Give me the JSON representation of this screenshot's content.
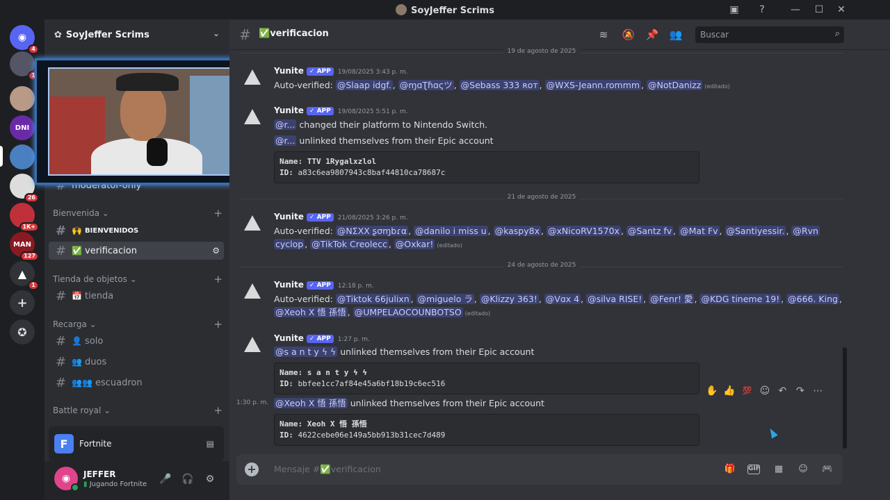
{
  "window": {
    "title": "SoyJeffer Scrims"
  },
  "rail": {
    "badges": [
      "4",
      "1",
      "1",
      "26",
      "1K+",
      "127",
      "1"
    ],
    "labels": {
      "dni": "DNI",
      "man": "MAN"
    }
  },
  "sidebar": {
    "guild_name": "SoyJeffer Scrims",
    "partial_channel": "moderator-only",
    "categories": {
      "bienvenida": "Bienvenida",
      "tienda": "Tienda de objetos",
      "recarga": "Recarga",
      "battle": "Battle royal"
    },
    "channels": {
      "bienvenidos": "BIENVENIDOS",
      "verificacion": "verificacion",
      "tienda": "tienda",
      "solo": "solo",
      "duos": "duos",
      "escuadron": "escuadron",
      "solo2": "solo"
    },
    "activity": {
      "app": "Fortnite",
      "icon_letter": "F"
    },
    "user": {
      "name": "JEFFER",
      "status": "Jugando Fortnite"
    }
  },
  "header": {
    "channel": "verificacion",
    "search_placeholder": "Buscar"
  },
  "messages": {
    "d1": "19 de agosto de 2025",
    "d2": "21 de agosto de 2025",
    "d3": "24 de agosto de 2025",
    "author": "Yunite",
    "app_tag": "APP",
    "edited": "(editado)",
    "m1": {
      "time": "19/08/2025 3:43 p. m.",
      "prefix": "Auto-verified:",
      "mentions": [
        "@Slaap idgf.",
        "@ɱɑƮɦɑςツ",
        "@Sebass 333 ʀᴏᴛ",
        "@WXS-Jeann.rommm",
        "@NotDanizz"
      ]
    },
    "m2": {
      "time": "19/08/2025 5:51 p. m.",
      "mention": "@r...",
      "line1": "changed their platform to Nintendo Switch.",
      "line2": "unlinked themselves from their Epic account",
      "code_name_label": "Name:",
      "code_name": "TTV 1Rygalxzlol",
      "code_id_label": "ID:",
      "code_id": "a83c6ea9807943c8baf44810ca78687c"
    },
    "m3": {
      "time": "21/08/2025 3:26 p. m.",
      "prefix": "Auto-verified:",
      "mentions_row1": [
        "@ΝΣΧΧ ʂσɱbɾα",
        "@danilo i miss u",
        "@kaspy8x",
        "@xNicoRV1570x",
        "@Santz fv",
        "@Mat Fv",
        "@Santiyessir.",
        "@Rvn"
      ],
      "mentions_row2": [
        "cyclop",
        "@TikTok Creolecc",
        "@Oxkar!"
      ]
    },
    "m4": {
      "time": "12:18 p. m.",
      "prefix": "Auto-verified:",
      "mentions_row1": [
        "@Tiktok 66julixn",
        "@miguelo ラ",
        "@Klizzy 363!",
        "@Vɑx 4",
        "@silva RISE!",
        "@Fenr! 愛",
        "@KDG tineme 19!",
        "@666. King"
      ],
      "mentions_row2": [
        "@Xeoh X 悟 孫悟",
        "@UMPELAOCOUNBOTSO"
      ]
    },
    "m5": {
      "time": "1:27 p. m.",
      "mention": "@s a n t y ϟ ϟ",
      "text": "unlinked themselves from their Epic account",
      "code_name": "s a n t y ϟ ϟ",
      "code_id": "bbfee1cc7af84e45a6bf18b19c6ec516"
    },
    "m6": {
      "hover_time": "1:30 p. m.",
      "mention": "@Xeoh X 悟 孫悟",
      "text": "unlinked themselves from their Epic account",
      "code_name": "Xeoh X 悟 孫悟",
      "code_id": "4622cebe06e149a5bb913b31cec7d489"
    }
  },
  "composer": {
    "placeholder": "Mensaje #",
    "channel": "verificacion",
    "gif": "GIF"
  },
  "colors": {
    "blurple": "#5865f2",
    "mention_bg": "#3c4270",
    "online": "#23a55a"
  }
}
